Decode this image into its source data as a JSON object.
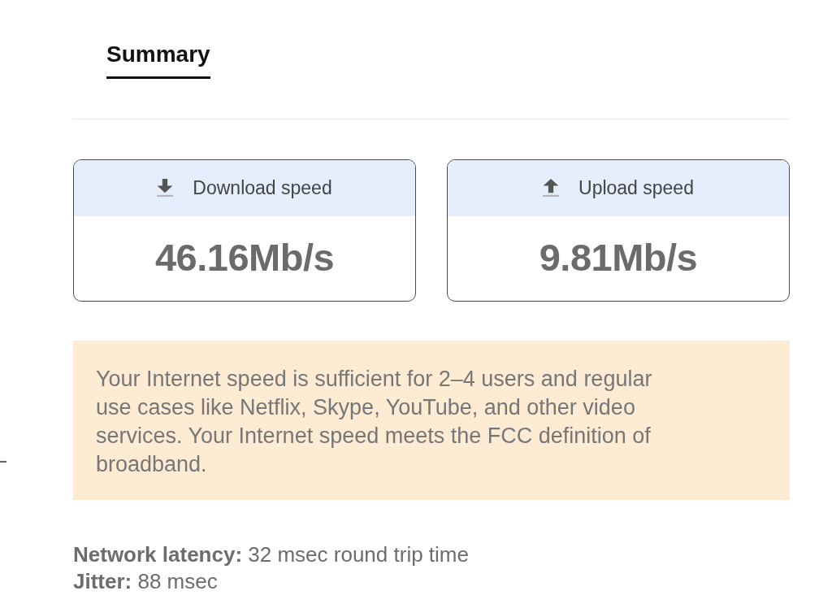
{
  "tabs": [
    {
      "label": "Summary",
      "selected": true
    }
  ],
  "speed_cards": [
    {
      "kind": "download",
      "label": "Download speed",
      "value": "46.16Mb/s"
    },
    {
      "kind": "upload",
      "label": "Upload speed",
      "value": "9.81Mb/s"
    }
  ],
  "notice": {
    "text": "Your Internet speed is sufficient for 2–4 users and regular use cases like Netflix, Skype, YouTube, and other video services. Your Internet speed meets the FCC definition of broadband."
  },
  "stats": [
    {
      "text": "**Network latency:** 32 msec round trip time"
    },
    {
      "text": "**Jitter:** 88 msec"
    }
  ]
}
